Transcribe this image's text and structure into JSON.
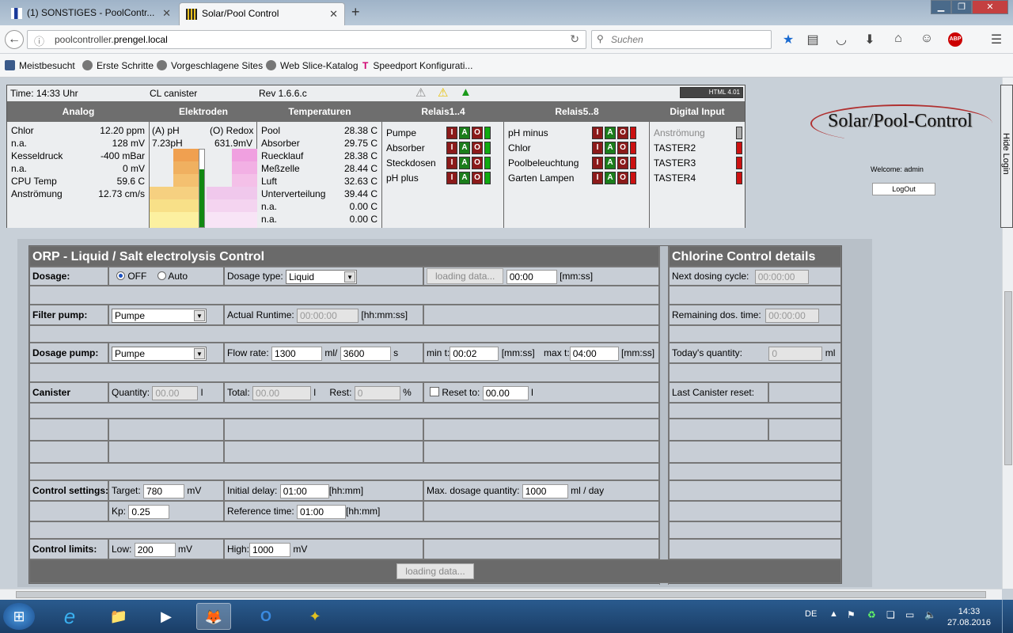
{
  "browser": {
    "tabs": [
      {
        "label": "(1) SONSTIGES - PoolContr..."
      },
      {
        "label": "Solar/Pool Control"
      }
    ],
    "url_prefix": "poolcontroller.",
    "url_domain": "prengel.local",
    "search_placeholder": "Suchen",
    "bookmarks": [
      "Meistbesucht",
      "Erste Schritte",
      "Vorgeschlagene Sites",
      "Web Slice-Katalog",
      "Speedport Konfigurati..."
    ]
  },
  "status": {
    "time": "Time: 14:33 Uhr",
    "canister": "CL canister",
    "rev": "Rev 1.6.6.c",
    "html_badge": "HTML 4.01",
    "headers": [
      "Analog",
      "Elektroden",
      "Temperaturen",
      "Relais1..4",
      "Relais5..8",
      "Digital Input"
    ],
    "analog": [
      {
        "label": "Chlor",
        "value": "12.20 ppm"
      },
      {
        "label": "n.a.",
        "value": "128 mV"
      },
      {
        "label": "Kesseldruck",
        "value": "-400 mBar"
      },
      {
        "label": "n.a.",
        "value": "0 mV"
      },
      {
        "label": "CPU Temp",
        "value": "59.6 C"
      },
      {
        "label": "Anströmung",
        "value": "12.73 cm/s"
      }
    ],
    "electrodes": {
      "ph_label": "(A) pH",
      "redox_label": "(O) Redox",
      "ph_value": "7.23pH",
      "redox_value": "631.9mV",
      "ph_level": 0.75
    },
    "temperatures": [
      {
        "label": "Pool",
        "value": "28.38 C"
      },
      {
        "label": "Absorber",
        "value": "29.75 C"
      },
      {
        "label": "Ruecklauf",
        "value": "28.38 C"
      },
      {
        "label": "Meßzelle",
        "value": "28.44 C"
      },
      {
        "label": "Luft",
        "value": "32.63 C"
      },
      {
        "label": "Unterverteilung",
        "value": "39.44 C"
      },
      {
        "label": "n.a.",
        "value": "0.00 C"
      },
      {
        "label": "n.a.",
        "value": "0.00 C"
      }
    ],
    "relais1": [
      {
        "label": "Pumpe",
        "state": "on"
      },
      {
        "label": "Absorber",
        "state": "on"
      },
      {
        "label": "Steckdosen",
        "state": "on"
      },
      {
        "label": "pH plus",
        "state": "on"
      }
    ],
    "relais2": [
      {
        "label": "pH minus",
        "state": "off"
      },
      {
        "label": "Chlor",
        "state": "off"
      },
      {
        "label": "Poolbeleuchtung",
        "state": "off"
      },
      {
        "label": "Garten Lampen",
        "state": "off"
      }
    ],
    "digital": [
      "Anströmung",
      "TASTER2",
      "TASTER3",
      "TASTER4"
    ],
    "iao": [
      "I",
      "A",
      "O"
    ]
  },
  "login": {
    "logo": "Solar/Pool-Control",
    "welcome": "Welcome: admin",
    "logout": "LogOut",
    "hide": "Hide Login"
  },
  "orp": {
    "title": "ORP - Liquid / Salt electrolysis Control",
    "details_title": "Chlorine Control details",
    "dosage_label": "Dosage:",
    "off_label": "OFF",
    "auto_label": "Auto",
    "dosage_type_label": "Dosage type:",
    "dosage_type_value": "Liquid",
    "loading": "loading data...",
    "manual_time": "00:00",
    "mmss": "[mm:ss]",
    "filter_pump_label": "Filter pump:",
    "filter_pump_value": "Pumpe",
    "actual_runtime_label": "Actual Runtime:",
    "actual_runtime_value": "00:00:00",
    "hhmmss": "[hh:mm:ss]",
    "dosage_pump_label": "Dosage pump:",
    "dosage_pump_value": "Pumpe",
    "flow_rate_label": "Flow rate:",
    "flow_rate_ml": "1300",
    "ml_per": "ml/",
    "flow_rate_s": "3600",
    "s": "s",
    "min_t_label": "min t:",
    "min_t_value": "00:02",
    "max_t_label": "max t:",
    "max_t_value": "04:00",
    "canister_label": "Canister",
    "quantity_label": "Quantity:",
    "quantity_value": "00.00",
    "l": "l",
    "total_label": "Total:",
    "total_value": "00.00",
    "rest_label": "Rest:",
    "rest_value": "0",
    "percent": "%",
    "reset_label": "Reset to:",
    "reset_value": "00.00",
    "control_settings_label": "Control settings:",
    "target_label": "Target:",
    "target_value": "780",
    "mv": "mV",
    "initial_delay_label": "Initial delay:",
    "initial_delay_value": "01:00",
    "hhmm": "[hh:mm]",
    "max_dosage_label": "Max. dosage quantity:",
    "max_dosage_value": "1000",
    "ml_day": "ml / day",
    "kp_label": "Kp:",
    "kp_value": "0.25",
    "reference_time_label": "Reference time:",
    "reference_time_value": "01:00",
    "control_limits_label": "Control limits:",
    "low_label": "Low:",
    "low_value": "200",
    "high_label": "High:",
    "high_value": "1000",
    "next_dosing_label": "Next dosing cycle:",
    "next_dosing_value": "00:00:00",
    "remaining_label": "Remaining dos. time:",
    "remaining_value": "00:00:00",
    "todays_label": "Today's quantity:",
    "todays_value": "0",
    "ml": "ml",
    "last_reset_label": "Last Canister reset:"
  },
  "taskbar": {
    "lang": "DE",
    "time": "14:33",
    "date": "27.08.2016"
  }
}
